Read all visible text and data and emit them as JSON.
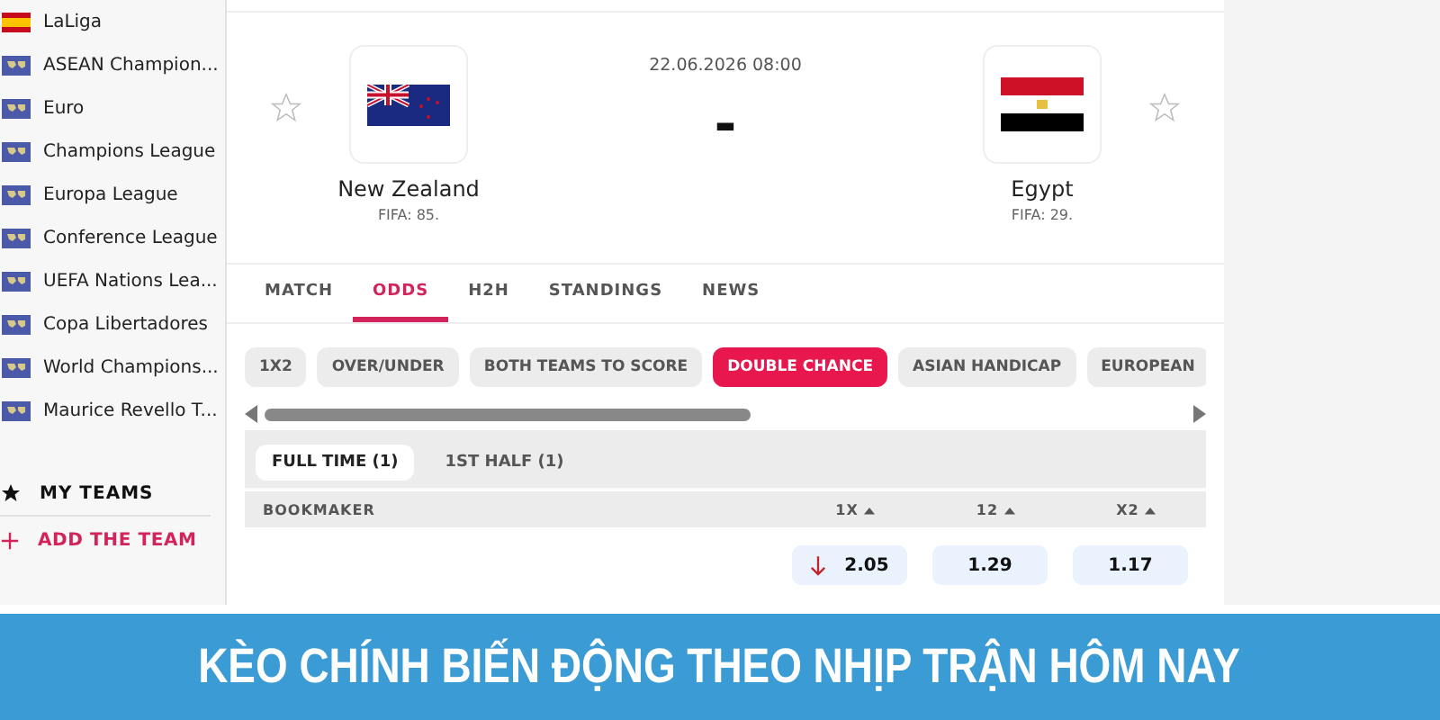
{
  "sidebar": {
    "leagues": [
      {
        "name": "LaLiga",
        "kind": "spain"
      },
      {
        "name": "ASEAN Champion...",
        "kind": "world"
      },
      {
        "name": "Euro",
        "kind": "world"
      },
      {
        "name": "Champions League",
        "kind": "world"
      },
      {
        "name": "Europa League",
        "kind": "world"
      },
      {
        "name": "Conference League",
        "kind": "world"
      },
      {
        "name": "UEFA Nations Lea...",
        "kind": "world"
      },
      {
        "name": "Copa Libertadores",
        "kind": "world"
      },
      {
        "name": "World Champions...",
        "kind": "world"
      },
      {
        "name": "Maurice Revello T...",
        "kind": "world"
      }
    ],
    "my_teams": "MY TEAMS",
    "add_team": "ADD THE TEAM"
  },
  "match": {
    "datetime": "22.06.2026 08:00",
    "score": "-",
    "home": {
      "name": "New Zealand",
      "ranking": "FIFA: 85.",
      "kind": "nz",
      "favorite": false
    },
    "away": {
      "name": "Egypt",
      "ranking": "FIFA: 29.",
      "kind": "egypt",
      "favorite": false
    }
  },
  "tabs": [
    {
      "label": "MATCH",
      "selected": false
    },
    {
      "label": "ODDS",
      "selected": true
    },
    {
      "label": "H2H",
      "selected": false
    },
    {
      "label": "STANDINGS",
      "selected": false
    },
    {
      "label": "NEWS",
      "selected": false
    }
  ],
  "markets": [
    {
      "label": "1X2",
      "selected": false
    },
    {
      "label": "OVER/UNDER",
      "selected": false
    },
    {
      "label": "BOTH TEAMS TO SCORE",
      "selected": false
    },
    {
      "label": "DOUBLE CHANCE",
      "selected": true
    },
    {
      "label": "ASIAN HANDICAP",
      "selected": false
    },
    {
      "label": "EUROPEAN",
      "selected": false
    }
  ],
  "periods": [
    {
      "label": "FULL TIME (1)",
      "selected": true
    },
    {
      "label": "1ST HALF (1)",
      "selected": false
    }
  ],
  "table": {
    "columns": [
      "BOOKMAKER",
      "1X",
      "12",
      "X2"
    ],
    "rows": [
      {
        "odds": [
          {
            "value": "2.05",
            "dropping": true
          },
          {
            "value": "1.29",
            "dropping": false
          },
          {
            "value": "1.17",
            "dropping": false
          }
        ]
      }
    ]
  },
  "banner": "KÈO CHÍNH BIẾN ĐỘNG THEO NHỊP TRẬN HÔM NAY"
}
